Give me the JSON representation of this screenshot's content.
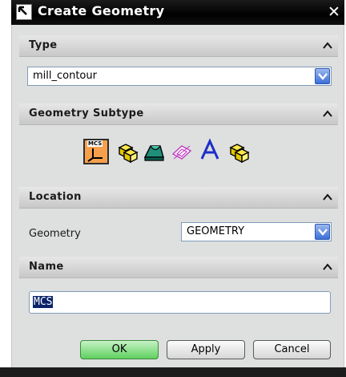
{
  "window": {
    "title": "Create Geometry",
    "close_glyph": "✕"
  },
  "sections": {
    "type": {
      "label": "Type",
      "combo_value": "mill_contour"
    },
    "subtype": {
      "label": "Geometry Subtype",
      "mcs_icon_text": "MCS",
      "items": [
        "mcs-icon",
        "workpiece-icon",
        "mill-area-icon",
        "mill-boundary-icon",
        "mill-text-icon",
        "mill-geom-icon"
      ]
    },
    "location": {
      "label": "Location",
      "geometry_label": "Geometry",
      "geometry_value": "GEOMETRY"
    },
    "name": {
      "label": "Name",
      "value": "MCS"
    }
  },
  "buttons": {
    "ok": "OK",
    "apply": "Apply",
    "cancel": "Cancel"
  },
  "colors": {
    "titlebar": "#000000",
    "section_header": "#d4d4d4",
    "ok_button": "#5fd05f",
    "selected_subtype": "#f6a04d",
    "combo_arrow": "#3a6fd8"
  }
}
